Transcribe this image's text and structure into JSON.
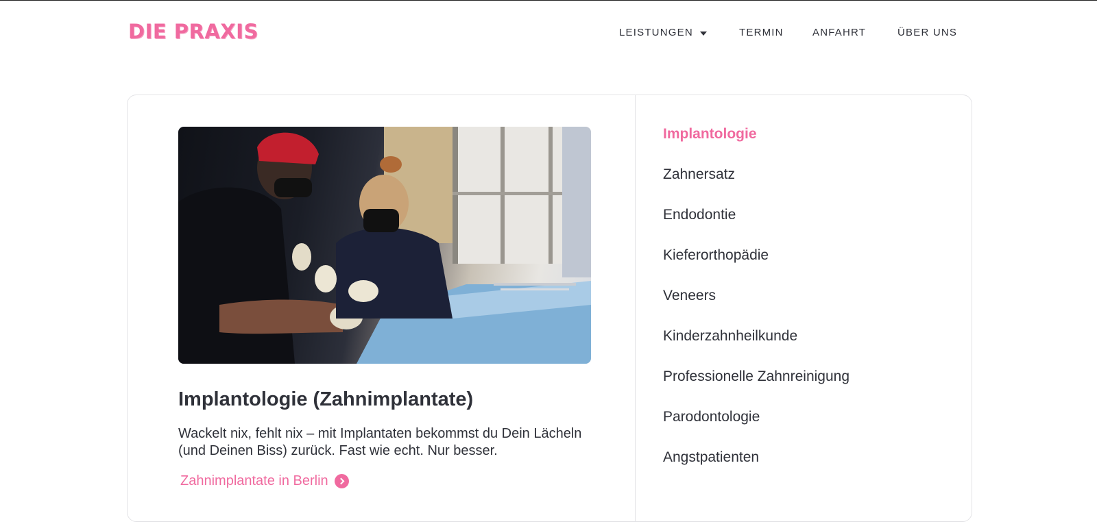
{
  "header": {
    "logo": "DIE PRAXIS",
    "nav": {
      "leistungen": "LEISTUNGEN",
      "termin": "TERMIN",
      "anfahrt": "ANFAHRT",
      "ueber_uns": "ÜBER UNS"
    }
  },
  "feature": {
    "image_alt": "Zahnärzte bei einer Implantat-Behandlung",
    "title": "Implantologie (Zahnimplantate)",
    "text": "Wackelt nix, fehlt nix – mit Implantaten bekommst du Dein Lächeln (und Deinen Biss) zurück. Fast wie echt. Nur besser.",
    "link_label": "Zahnimplantate in Berlin"
  },
  "services": [
    "Implantologie",
    "Zahnersatz",
    "Endodontie",
    "Kieferorthopädie",
    "Veneers",
    "Kinderzahnheilkunde",
    "Professionelle Zahnreinigung",
    "Parodontologie",
    "Angstpatienten"
  ],
  "colors": {
    "accent": "#f06a9f",
    "text": "#2f3139",
    "border": "#e3e3e6"
  }
}
